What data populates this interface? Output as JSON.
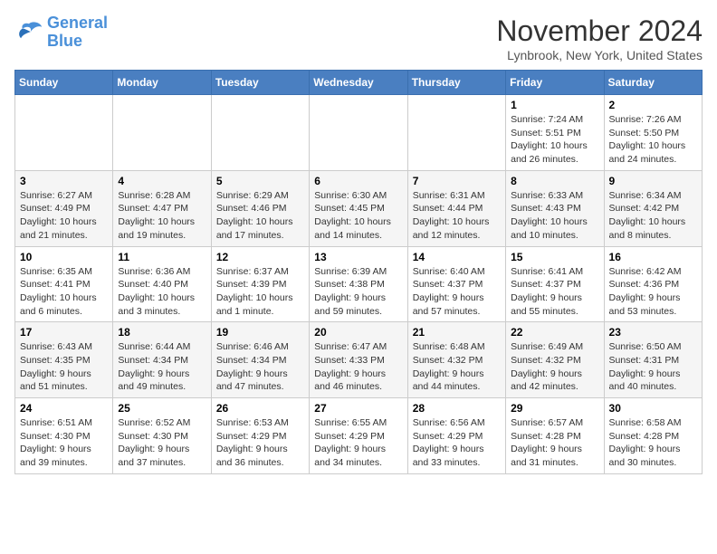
{
  "logo": {
    "line1": "General",
    "line2": "Blue"
  },
  "title": "November 2024",
  "location": "Lynbrook, New York, United States",
  "weekdays": [
    "Sunday",
    "Monday",
    "Tuesday",
    "Wednesday",
    "Thursday",
    "Friday",
    "Saturday"
  ],
  "weeks": [
    [
      {
        "day": "",
        "info": ""
      },
      {
        "day": "",
        "info": ""
      },
      {
        "day": "",
        "info": ""
      },
      {
        "day": "",
        "info": ""
      },
      {
        "day": "",
        "info": ""
      },
      {
        "day": "1",
        "info": "Sunrise: 7:24 AM\nSunset: 5:51 PM\nDaylight: 10 hours\nand 26 minutes."
      },
      {
        "day": "2",
        "info": "Sunrise: 7:26 AM\nSunset: 5:50 PM\nDaylight: 10 hours\nand 24 minutes."
      }
    ],
    [
      {
        "day": "3",
        "info": "Sunrise: 6:27 AM\nSunset: 4:49 PM\nDaylight: 10 hours\nand 21 minutes."
      },
      {
        "day": "4",
        "info": "Sunrise: 6:28 AM\nSunset: 4:47 PM\nDaylight: 10 hours\nand 19 minutes."
      },
      {
        "day": "5",
        "info": "Sunrise: 6:29 AM\nSunset: 4:46 PM\nDaylight: 10 hours\nand 17 minutes."
      },
      {
        "day": "6",
        "info": "Sunrise: 6:30 AM\nSunset: 4:45 PM\nDaylight: 10 hours\nand 14 minutes."
      },
      {
        "day": "7",
        "info": "Sunrise: 6:31 AM\nSunset: 4:44 PM\nDaylight: 10 hours\nand 12 minutes."
      },
      {
        "day": "8",
        "info": "Sunrise: 6:33 AM\nSunset: 4:43 PM\nDaylight: 10 hours\nand 10 minutes."
      },
      {
        "day": "9",
        "info": "Sunrise: 6:34 AM\nSunset: 4:42 PM\nDaylight: 10 hours\nand 8 minutes."
      }
    ],
    [
      {
        "day": "10",
        "info": "Sunrise: 6:35 AM\nSunset: 4:41 PM\nDaylight: 10 hours\nand 6 minutes."
      },
      {
        "day": "11",
        "info": "Sunrise: 6:36 AM\nSunset: 4:40 PM\nDaylight: 10 hours\nand 3 minutes."
      },
      {
        "day": "12",
        "info": "Sunrise: 6:37 AM\nSunset: 4:39 PM\nDaylight: 10 hours\nand 1 minute."
      },
      {
        "day": "13",
        "info": "Sunrise: 6:39 AM\nSunset: 4:38 PM\nDaylight: 9 hours\nand 59 minutes."
      },
      {
        "day": "14",
        "info": "Sunrise: 6:40 AM\nSunset: 4:37 PM\nDaylight: 9 hours\nand 57 minutes."
      },
      {
        "day": "15",
        "info": "Sunrise: 6:41 AM\nSunset: 4:37 PM\nDaylight: 9 hours\nand 55 minutes."
      },
      {
        "day": "16",
        "info": "Sunrise: 6:42 AM\nSunset: 4:36 PM\nDaylight: 9 hours\nand 53 minutes."
      }
    ],
    [
      {
        "day": "17",
        "info": "Sunrise: 6:43 AM\nSunset: 4:35 PM\nDaylight: 9 hours\nand 51 minutes."
      },
      {
        "day": "18",
        "info": "Sunrise: 6:44 AM\nSunset: 4:34 PM\nDaylight: 9 hours\nand 49 minutes."
      },
      {
        "day": "19",
        "info": "Sunrise: 6:46 AM\nSunset: 4:34 PM\nDaylight: 9 hours\nand 47 minutes."
      },
      {
        "day": "20",
        "info": "Sunrise: 6:47 AM\nSunset: 4:33 PM\nDaylight: 9 hours\nand 46 minutes."
      },
      {
        "day": "21",
        "info": "Sunrise: 6:48 AM\nSunset: 4:32 PM\nDaylight: 9 hours\nand 44 minutes."
      },
      {
        "day": "22",
        "info": "Sunrise: 6:49 AM\nSunset: 4:32 PM\nDaylight: 9 hours\nand 42 minutes."
      },
      {
        "day": "23",
        "info": "Sunrise: 6:50 AM\nSunset: 4:31 PM\nDaylight: 9 hours\nand 40 minutes."
      }
    ],
    [
      {
        "day": "24",
        "info": "Sunrise: 6:51 AM\nSunset: 4:30 PM\nDaylight: 9 hours\nand 39 minutes."
      },
      {
        "day": "25",
        "info": "Sunrise: 6:52 AM\nSunset: 4:30 PM\nDaylight: 9 hours\nand 37 minutes."
      },
      {
        "day": "26",
        "info": "Sunrise: 6:53 AM\nSunset: 4:29 PM\nDaylight: 9 hours\nand 36 minutes."
      },
      {
        "day": "27",
        "info": "Sunrise: 6:55 AM\nSunset: 4:29 PM\nDaylight: 9 hours\nand 34 minutes."
      },
      {
        "day": "28",
        "info": "Sunrise: 6:56 AM\nSunset: 4:29 PM\nDaylight: 9 hours\nand 33 minutes."
      },
      {
        "day": "29",
        "info": "Sunrise: 6:57 AM\nSunset: 4:28 PM\nDaylight: 9 hours\nand 31 minutes."
      },
      {
        "day": "30",
        "info": "Sunrise: 6:58 AM\nSunset: 4:28 PM\nDaylight: 9 hours\nand 30 minutes."
      }
    ]
  ]
}
